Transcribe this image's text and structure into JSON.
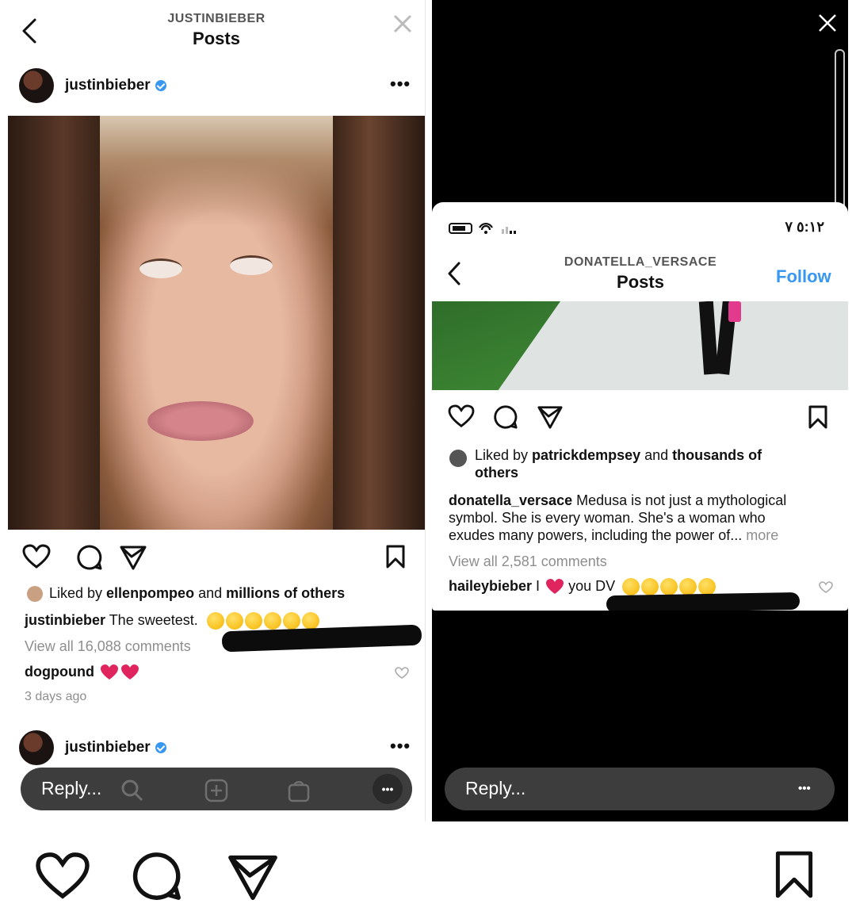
{
  "left_post": {
    "header_account": "JUSTINBIEBER",
    "header_title": "Posts",
    "username": "justinbieber",
    "liked_prefix": "Liked by ",
    "liked_user": "ellenpompeo",
    "liked_mid": " and ",
    "liked_suffix": "millions of others",
    "caption_user": "justinbieber",
    "caption_text": " The sweetest.",
    "view_comments": "View all 16,088 comments",
    "comment_user": "dogpound",
    "comment_time": "3 days ago",
    "next_username": "justinbieber",
    "reply_placeholder": "Reply..."
  },
  "right_post": {
    "status_time": "٥:١٢ ٧",
    "header_account": "DONATELLA_VERSACE",
    "header_title": "Posts",
    "follow_label": "Follow",
    "liked_prefix": "Liked by ",
    "liked_user": "patrickdempsey",
    "liked_mid": " and ",
    "liked_suffix": "thousands of",
    "liked_suffix2": "others",
    "caption_user": "donatella_versace",
    "caption_line1": " Medusa is not just a mythological",
    "caption_line2": "symbol. She is every woman. She's a woman who",
    "caption_line3": "exudes many powers, including the power of...",
    "caption_more": " more",
    "view_comments": "View all 2,581 comments",
    "comment_user": "haileybieber",
    "comment_pre": " I ",
    "comment_post": " you DV",
    "reply_placeholder": "Reply..."
  },
  "icons": {
    "like": "heart-icon",
    "comment": "comment-icon",
    "share": "send-icon",
    "save": "bookmark-icon",
    "more": "more-dots-icon",
    "close": "close-icon",
    "back": "chevron-left-icon"
  },
  "colors": {
    "accent": "#3897f0",
    "dark_bar": "#3d3d3d"
  }
}
